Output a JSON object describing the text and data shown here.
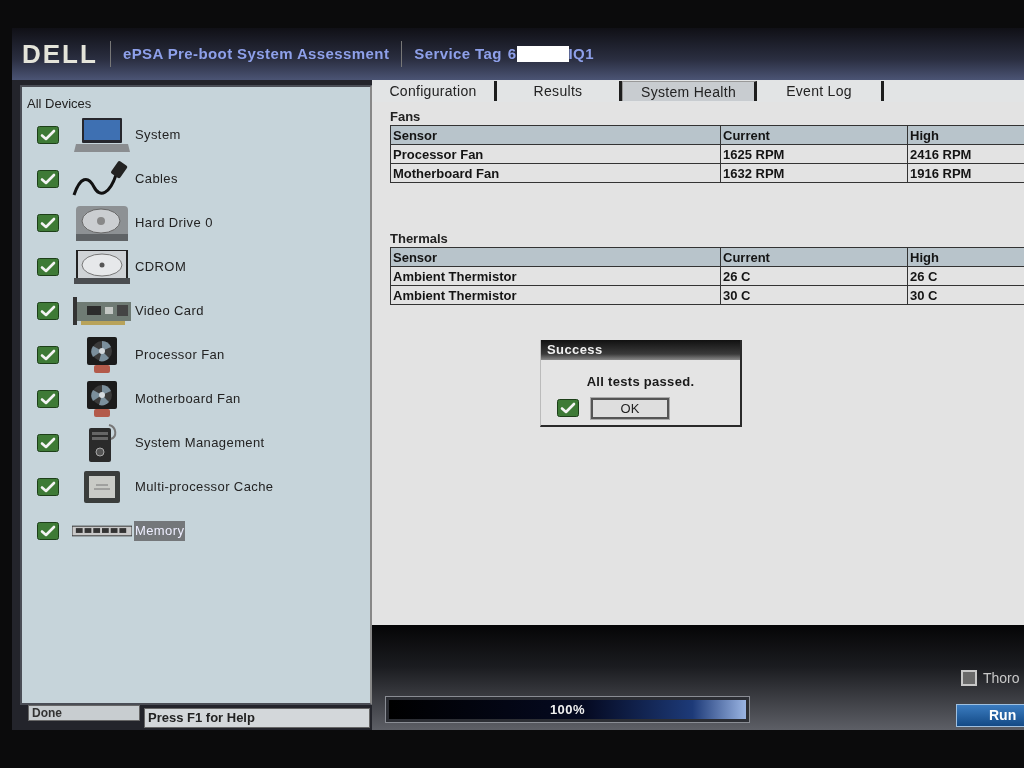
{
  "header": {
    "logo": "DELL",
    "title": "ePSA Pre-boot System Assessment",
    "service_tag": {
      "label": "Service Tag",
      "value_start": "6",
      "value_end": "IQ1"
    }
  },
  "sidebar": {
    "title": "All Devices",
    "items": [
      {
        "label": "System",
        "kind": "laptop",
        "checked": true,
        "selected": false
      },
      {
        "label": "Cables",
        "kind": "cable",
        "checked": true,
        "selected": false
      },
      {
        "label": "Hard Drive 0",
        "kind": "disk",
        "checked": true,
        "selected": false
      },
      {
        "label": "CDROM",
        "kind": "optical",
        "checked": true,
        "selected": false
      },
      {
        "label": "Video Card",
        "kind": "card",
        "checked": true,
        "selected": false
      },
      {
        "label": "Processor Fan",
        "kind": "fan",
        "checked": true,
        "selected": false
      },
      {
        "label": "Motherboard Fan",
        "kind": "fan",
        "checked": true,
        "selected": false
      },
      {
        "label": "System Management",
        "kind": "tower",
        "checked": true,
        "selected": false
      },
      {
        "label": "Multi-processor Cache",
        "kind": "chip",
        "checked": true,
        "selected": false
      },
      {
        "label": "Memory",
        "kind": "memory",
        "checked": true,
        "selected": true
      }
    ]
  },
  "tabs": [
    {
      "label": "Configuration",
      "selected": false
    },
    {
      "label": "Results",
      "selected": false
    },
    {
      "label": "System Health",
      "selected": true
    },
    {
      "label": "Event Log",
      "selected": false
    }
  ],
  "sections": [
    {
      "title": "Fans",
      "table": {
        "columns": [
          "Sensor",
          "Current",
          "High"
        ],
        "rows": [
          [
            "Processor Fan",
            "1625 RPM",
            "2416 RPM"
          ],
          [
            "Motherboard Fan",
            "1632 RPM",
            "1916 RPM"
          ]
        ]
      }
    },
    {
      "title": "Thermals",
      "table": {
        "columns": [
          "Sensor",
          "Current",
          "High"
        ],
        "rows": [
          [
            "Ambient Thermistor",
            "26 C",
            "26 C"
          ],
          [
            "Ambient Thermistor",
            "30 C",
            "30 C"
          ]
        ]
      }
    }
  ],
  "dialog": {
    "title": "Success",
    "message": "All tests passed.",
    "button": "OK"
  },
  "progress": {
    "level": 1,
    "label": "100%"
  },
  "option_checkbox": {
    "label": "Thoro",
    "checked": false
  },
  "run_button": "Run",
  "status_bar": {
    "state": "Done",
    "hint": "Press F1 for Help"
  }
}
